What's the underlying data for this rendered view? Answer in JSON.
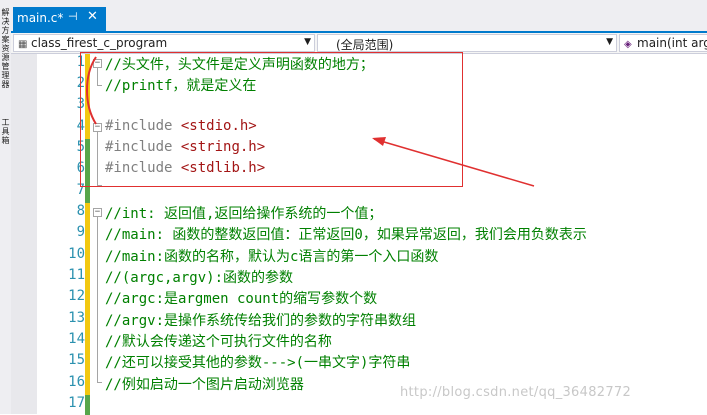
{
  "toolstrip": {
    "label1": "解决方案资源管理器",
    "label2": "工具箱"
  },
  "tab": {
    "title": "main.c*",
    "pin_icon": "pin-icon",
    "close_icon": "close-icon"
  },
  "nav": {
    "project": "class_firest_c_program",
    "scope": "(全局范围)",
    "member": "main(int arg"
  },
  "lines": [
    {
      "num": "1",
      "text": "//头文件，头文件是定义声明函数的地方；",
      "kind": "comment"
    },
    {
      "num": "2",
      "text": "//printf，就是定义在",
      "kind": "comment"
    },
    {
      "num": "3",
      "text": "",
      "kind": "plain"
    },
    {
      "num": "4",
      "text": "#include",
      "kind": "include",
      "arg": "<stdio.h>"
    },
    {
      "num": "5",
      "text": "#include",
      "kind": "include",
      "arg": "<string.h>"
    },
    {
      "num": "6",
      "text": "#include",
      "kind": "include",
      "arg": "<stdlib.h>"
    },
    {
      "num": "7",
      "text": "",
      "kind": "plain"
    },
    {
      "num": "8",
      "text": "//int: 返回值,返回给操作系统的一个值；",
      "kind": "comment"
    },
    {
      "num": "9",
      "text": "//main: 函数的整数返回值：正常返回0，如果异常返回，我们会用负数表示",
      "kind": "comment"
    },
    {
      "num": "10",
      "text": "//main:函数的名称，默认为c语言的第一个入口函数",
      "kind": "comment"
    },
    {
      "num": "11",
      "text": "//(argc,argv):函数的参数",
      "kind": "comment"
    },
    {
      "num": "12",
      "text": "//argc:是argmen count的缩写参数个数",
      "kind": "comment"
    },
    {
      "num": "13",
      "text": "//argv:是操作系统传给我们的参数的字符串数组",
      "kind": "comment"
    },
    {
      "num": "14",
      "text": "//默认会传递这个可执行文件的名称",
      "kind": "comment"
    },
    {
      "num": "15",
      "text": "//还可以接受其他的参数--->(一串文字)字符串",
      "kind": "comment"
    },
    {
      "num": "16",
      "text": "//例如启动一个图片启动浏览器",
      "kind": "comment"
    },
    {
      "num": "17",
      "text": "",
      "kind": "plain"
    }
  ],
  "watermark": "http://blog.csdn.net/qq_36482772",
  "colors": {
    "accent": "#007acc",
    "comment": "#008000",
    "preprocessor": "#808080",
    "string": "#a31515",
    "line_number": "#2b91af",
    "change_saved": "#57a64a",
    "change_unsaved": "#f2c811",
    "annotation": "#e03030"
  }
}
